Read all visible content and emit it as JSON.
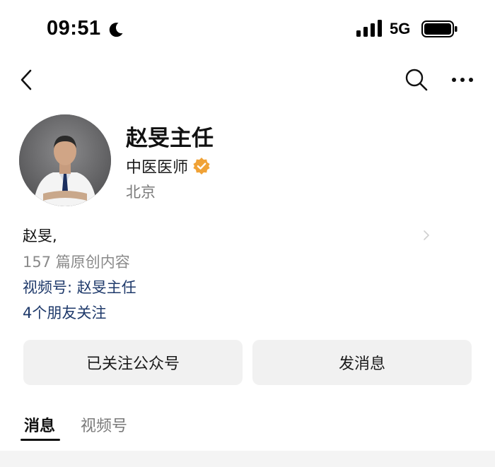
{
  "status_bar": {
    "time": "09:51",
    "network": "5G",
    "icons": [
      "moon-icon",
      "signal-icon",
      "battery-icon"
    ]
  },
  "nav": {
    "icons": [
      "back-arrow-icon",
      "search-icon",
      "more-icon"
    ]
  },
  "profile": {
    "name": "赵旻主任",
    "title": "中医医师",
    "verified_icon": "verified-badge-icon",
    "verified_color": "#f0a236",
    "location": "北京",
    "bio": "赵旻,",
    "article_count": "157 篇原创内容",
    "channel_link": "视频号: 赵旻主任",
    "friends_following": "4个朋友关注",
    "link_color": "#1f3a6b"
  },
  "actions": {
    "follow_label": "已关注公众号",
    "message_label": "发消息"
  },
  "tabs": [
    {
      "label": "消息",
      "active": true
    },
    {
      "label": "视频号",
      "active": false
    }
  ]
}
